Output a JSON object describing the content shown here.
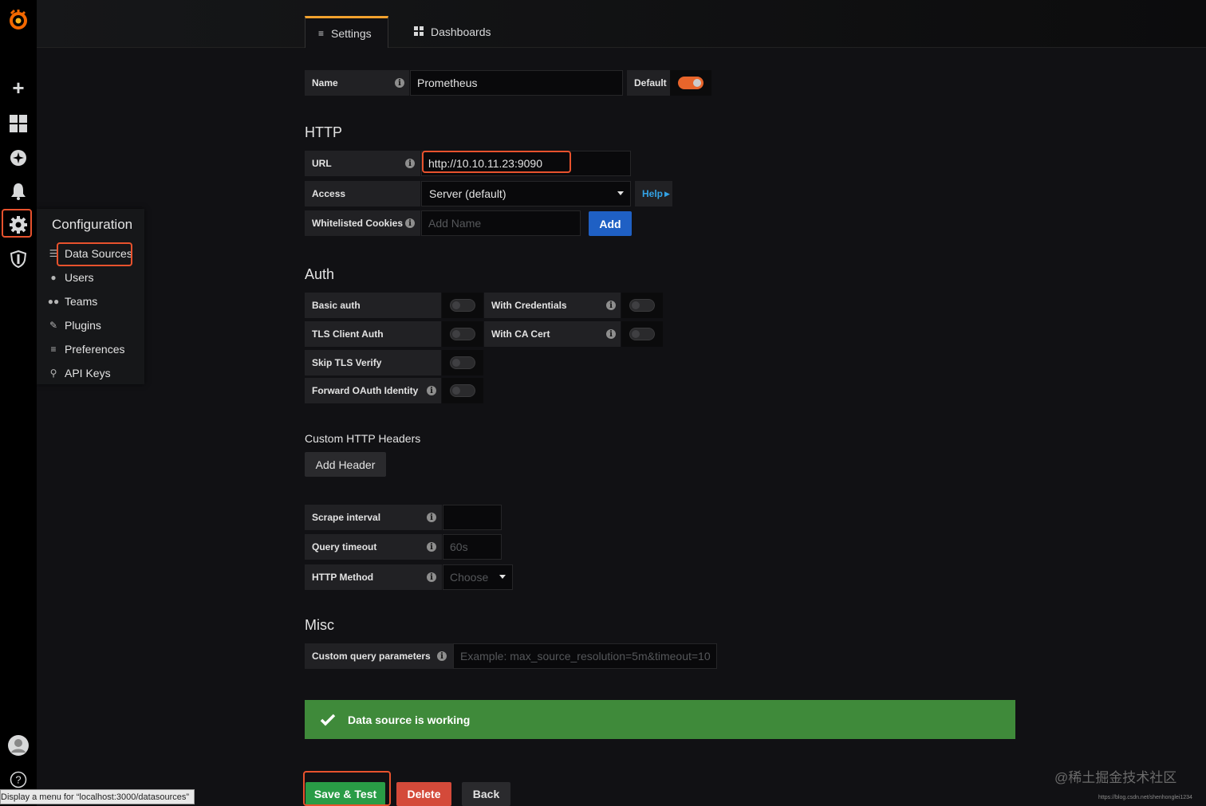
{
  "tabs": [
    {
      "label": "Settings",
      "icon": "sliders-icon"
    },
    {
      "label": "Dashboards",
      "icon": "dashboards-icon"
    }
  ],
  "sidebar": {
    "icons": [
      "grafana-logo",
      "plus-icon",
      "dashboards-icon",
      "explore-icon",
      "bell-icon",
      "gear-icon",
      "shield-icon",
      "avatar",
      "help-icon"
    ]
  },
  "flyout": {
    "title": "Configuration",
    "items": [
      {
        "label": "Data Sources",
        "icon": "database-icon"
      },
      {
        "label": "Users",
        "icon": "user-icon"
      },
      {
        "label": "Teams",
        "icon": "users-icon"
      },
      {
        "label": "Plugins",
        "icon": "plug-icon"
      },
      {
        "label": "Preferences",
        "icon": "sliders-icon"
      },
      {
        "label": "API Keys",
        "icon": "key-icon"
      }
    ]
  },
  "general": {
    "name_label": "Name",
    "name_value": "Prometheus",
    "default_label": "Default",
    "default_on": true
  },
  "http": {
    "title": "HTTP",
    "url_label": "URL",
    "url_value": "http://10.10.11.23:9090",
    "access_label": "Access",
    "access_value": "Server (default)",
    "help_label": "Help",
    "cookies_label": "Whitelisted Cookies",
    "cookies_placeholder": "Add Name",
    "add_label": "Add"
  },
  "auth": {
    "title": "Auth",
    "basic_auth": "Basic auth",
    "with_credentials": "With Credentials",
    "tls_client_auth": "TLS Client Auth",
    "with_ca_cert": "With CA Cert",
    "skip_tls": "Skip TLS Verify",
    "forward_oauth": "Forward OAuth Identity"
  },
  "headers": {
    "title": "Custom HTTP Headers",
    "add_header": "Add Header"
  },
  "prometheus": {
    "scrape_label": "Scrape interval",
    "scrape_value": "",
    "timeout_label": "Query timeout",
    "timeout_placeholder": "60s",
    "method_label": "HTTP Method",
    "method_placeholder": "Choose"
  },
  "misc": {
    "title": "Misc",
    "custom_query_label": "Custom query parameters",
    "custom_query_placeholder": "Example: max_source_resolution=5m&timeout=10"
  },
  "alert": {
    "text": "Data source is working",
    "color": "#3f8a3a"
  },
  "actions": {
    "save_test": "Save & Test",
    "delete": "Delete",
    "back": "Back"
  },
  "statusbar": "Display a menu for “localhost:3000/datasources”",
  "watermark": "@稀土掘金技术社区",
  "watermark_url": "https://blog.csdn.net/shenhonglei1234",
  "colors": {
    "accent": "#e8652b",
    "primary_button": "#1f60c4",
    "success_button": "#299c46",
    "danger_button": "#d44a3a",
    "highlight": "#e8522d"
  }
}
